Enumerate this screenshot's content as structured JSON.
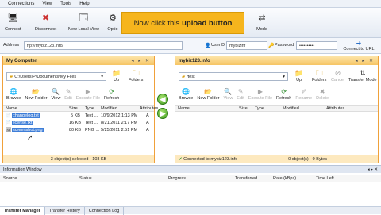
{
  "menu": [
    "Connections",
    "View",
    "Tools",
    "Help"
  ],
  "toolbar": {
    "connect": "Connect",
    "disconnect": "Disconnect",
    "new_local_view": "New Local View",
    "options": "Optio",
    "mode": "Mode"
  },
  "callout": {
    "prefix": "Now click this",
    "emphasis": "upload button"
  },
  "address_bar": {
    "address_label": "Address",
    "address_value": "ftp://mybiz123.info/",
    "userid_label": "UserID",
    "userid_value": "mybizinf",
    "password_label": "Password",
    "password_value": "••••••••••",
    "connect_url_label": "Connect to URL"
  },
  "left_pane": {
    "title": "My Computer",
    "controls": "◂ ▸ ✕",
    "path": "C:\\Users\\P\\Documents\\My Files",
    "up": "Up",
    "folders": "Folders",
    "actions": [
      {
        "label": "Browse",
        "enabled": true
      },
      {
        "label": "New Folder",
        "enabled": true
      },
      {
        "label": "View",
        "enabled": true
      },
      {
        "label": "Edit",
        "enabled": false
      },
      {
        "label": "Execute File",
        "enabled": false
      },
      {
        "label": "Refresh",
        "enabled": true
      }
    ],
    "columns": [
      "Name",
      "Size",
      "Type",
      "Modified",
      "Attributes"
    ],
    "files": [
      {
        "name": "changelog.txt",
        "size": "5 KB",
        "type": "Text ...",
        "modified": "10/9/2012 1:13 PM",
        "attr": "A"
      },
      {
        "name": "license.txt",
        "size": "16 KB",
        "type": "Text ...",
        "modified": "8/21/2011 2:17 PM",
        "attr": "A"
      },
      {
        "name": "screenshot.png",
        "size": "80 KB",
        "type": "PNG ...",
        "modified": "5/25/2011 2:51 PM",
        "attr": "A"
      }
    ],
    "status": "3 object(s) selected - 103 KB"
  },
  "right_pane": {
    "title": "mybiz123.info",
    "controls": "◂ ▸ ✕",
    "path": "/test",
    "up": "Up",
    "folders": "Folders",
    "cancel": "Cancel",
    "transfer_mode": "Transfer Mode",
    "actions": [
      {
        "label": "Browse",
        "enabled": true
      },
      {
        "label": "New Folder",
        "enabled": true
      },
      {
        "label": "View",
        "enabled": false
      },
      {
        "label": "Edit",
        "enabled": false
      },
      {
        "label": "Execute File",
        "enabled": false
      },
      {
        "label": "Refresh",
        "enabled": true
      },
      {
        "label": "Rename",
        "enabled": false
      },
      {
        "label": "Delete",
        "enabled": false
      }
    ],
    "columns": [
      "Name",
      "Size",
      "Type",
      "Modified",
      "Attributes"
    ],
    "status_left": "Connected to mybiz123.info",
    "status_right": "0 object(s) - 0 Bytes"
  },
  "info_window": {
    "title": "Information Window",
    "controls": "◂ ▸ ✕",
    "columns": [
      "Source",
      "Status",
      "Progress",
      "Transferred",
      "Rate (kBps)",
      "Time Left"
    ]
  },
  "bottom_tabs": [
    "Transfer Manager",
    "Transfer History",
    "Connection Log"
  ],
  "colors": {
    "accent": "#f6b51d",
    "pane_border": "#f0a13a",
    "selection": "#3e7ed8",
    "arrow_green": "#3d9a1d"
  }
}
